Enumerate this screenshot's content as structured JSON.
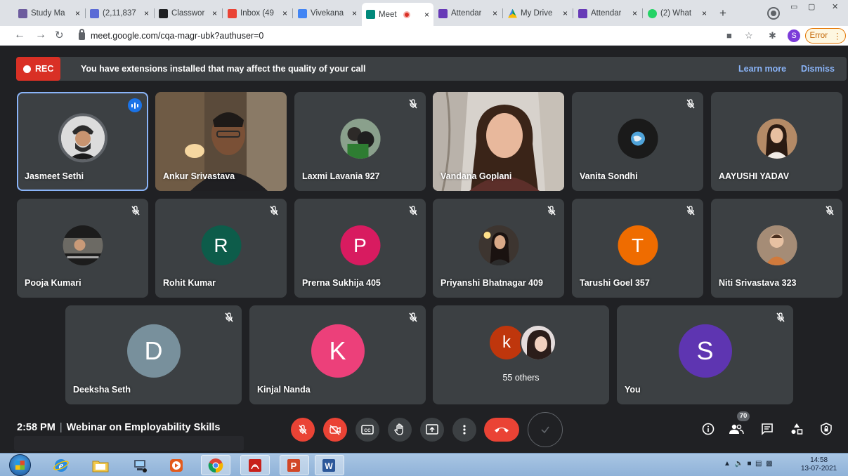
{
  "browser": {
    "tabs": [
      {
        "label": "Study Ma",
        "fav": "#6d5c9e"
      },
      {
        "label": "(2,11,837",
        "fav": "#5b6bd6"
      },
      {
        "label": "Classwor",
        "fav": "#202124"
      },
      {
        "label": "Inbox (49",
        "fav": "#ea4335"
      },
      {
        "label": "Vivekana",
        "fav": "#4285f4"
      },
      {
        "label": "Meet",
        "fav": "#00897b"
      },
      {
        "label": "Attendar",
        "fav": "#673ab7"
      },
      {
        "label": "My Drive",
        "fav": "#fbbc04"
      },
      {
        "label": "Attendar",
        "fav": "#673ab7"
      },
      {
        "label": "(2) What",
        "fav": "#25d366"
      }
    ],
    "tab_close": "×",
    "new_tab": "+",
    "url": "meet.google.com/cqa-magr-ubk?authuser=0",
    "profile_letter": "S",
    "error_label": "Error"
  },
  "meet": {
    "rec_label": "REC",
    "banner_text": "You have extensions installed that may affect the quality of your call",
    "learn_more": "Learn more",
    "dismiss": "Dismiss",
    "participants": [
      {
        "name": "Jasmeet Sethi"
      },
      {
        "name": "Ankur Srivastava"
      },
      {
        "name": "Laxmi Lavania 927"
      },
      {
        "name": "Vandana Goplani"
      },
      {
        "name": "Vanita Sondhi"
      },
      {
        "name": "AAYUSHI YADAV"
      },
      {
        "name": "Pooja Kumari"
      },
      {
        "name": "Rohit Kumar",
        "letter": "R",
        "color": "#0d5c4a"
      },
      {
        "name": "Prerna Sukhija 405",
        "letter": "P",
        "color": "#d81b60"
      },
      {
        "name": "Priyanshi Bhatnagar 409"
      },
      {
        "name": "Tarushi Goel 357",
        "letter": "T",
        "color": "#ef6c00"
      },
      {
        "name": "Niti Srivastava 323"
      },
      {
        "name": "Deeksha Seth",
        "letter": "D",
        "color": "#78909c"
      },
      {
        "name": "Kinjal Nanda",
        "letter": "K",
        "color": "#ec407a"
      },
      {
        "name": "55 others",
        "letter": "k",
        "color": "#bf360c"
      },
      {
        "name": "You",
        "letter": "S",
        "color": "#5e35b1"
      }
    ],
    "time": "2:58 PM",
    "meeting_title": "Webinar on Employability Skills",
    "people_count": "70"
  },
  "taskbar": {
    "clock_time": "14:58",
    "clock_date": "13-07-2021"
  },
  "colors": {
    "meet_bg": "#202124",
    "tile_bg": "#3c4043",
    "rec_red": "#d93025",
    "link_blue": "#8ab4f8",
    "speaking_blue": "#1a73e8"
  }
}
